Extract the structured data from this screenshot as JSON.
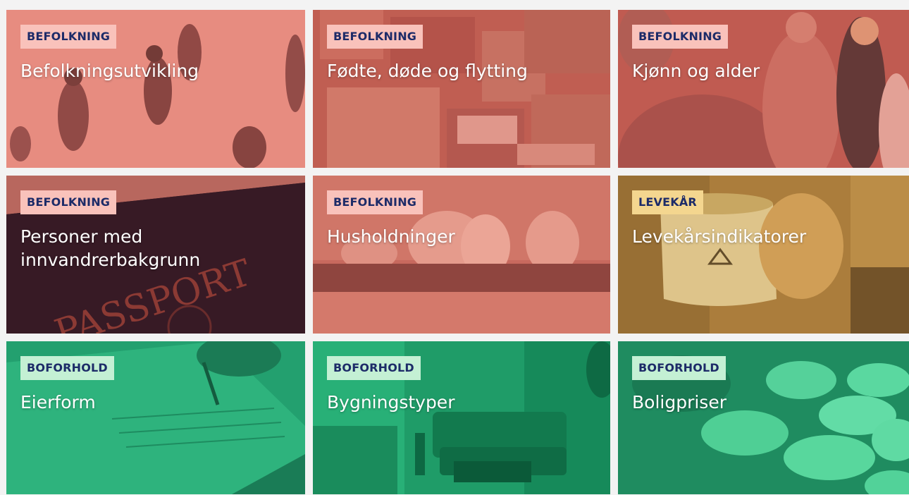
{
  "tiles": [
    {
      "tag": "BEFOLKNING",
      "title": "Befolkningsutvikling"
    },
    {
      "tag": "BEFOLKNING",
      "title": "Fødte, døde og flytting"
    },
    {
      "tag": "BEFOLKNING",
      "title": "Kjønn og alder"
    },
    {
      "tag": "BEFOLKNING",
      "title": "Personer med innvandrerbakgrunn"
    },
    {
      "tag": "BEFOLKNING",
      "title": "Husholdninger"
    },
    {
      "tag": "LEVEKÅR",
      "title": "Levekårsindikatorer"
    },
    {
      "tag": "BOFORHOLD",
      "title": "Eierform"
    },
    {
      "tag": "BOFORHOLD",
      "title": "Bygningstyper"
    },
    {
      "tag": "BOFORHOLD",
      "title": "Boligpriser"
    }
  ],
  "colors": {
    "befolkning_overlay": "#d9695f",
    "levekar_overlay": "#c99a45",
    "boforhold_overlay": "#2aa876",
    "tag_text": "#1d2b68"
  }
}
